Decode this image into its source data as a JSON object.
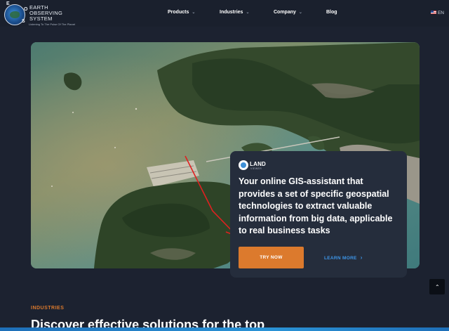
{
  "brand": {
    "line1": "EARTH",
    "line2": "OBSERVING",
    "line3": "SYSTEM",
    "tagline": "Listening To The Pulse Of The Planet",
    "letters": [
      "E",
      "O",
      "S"
    ]
  },
  "nav": {
    "items": [
      {
        "label": "Products",
        "has_dropdown": true
      },
      {
        "label": "Industries",
        "has_dropdown": true
      },
      {
        "label": "Company",
        "has_dropdown": true
      },
      {
        "label": "Blog",
        "has_dropdown": false
      }
    ],
    "language": "EN"
  },
  "hero": {
    "image": "satellite-imagery-coastline"
  },
  "card": {
    "logo_name": "LAND",
    "logo_sub": "VIEWER",
    "text": "Your online GIS-assistant that provides a set of specific geospatial technologies to extract valuable information from big data, applicable to real business tasks",
    "primary_button": "TRY NOW",
    "secondary_button": "LEARN MORE"
  },
  "annotation": {
    "color": "#e02020"
  },
  "section": {
    "label": "INDUSTRIES",
    "title": "Discover effective solutions for the top"
  },
  "colors": {
    "background": "#1c2230",
    "card": "#252d3c",
    "accent_orange": "#dc7a2d",
    "link_blue": "#3d95e8"
  },
  "icons": {
    "scroll_top": "chevron-up-icon",
    "learn_more": "chevron-right-icon"
  }
}
